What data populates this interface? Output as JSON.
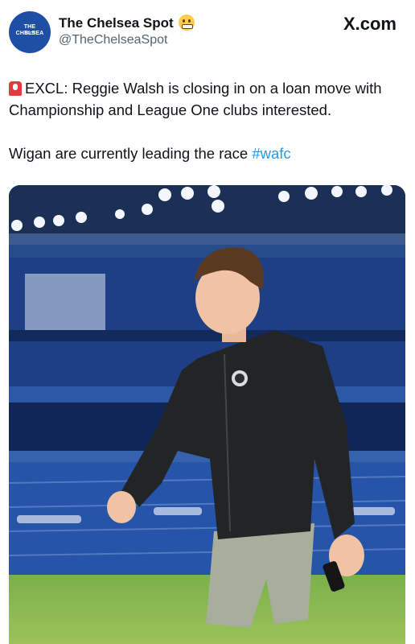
{
  "header": {
    "display_name": "The Chelsea Spot",
    "handle": "@TheChelseaSpot",
    "platform_logo": "X.com",
    "avatar": {
      "line1": "THE",
      "line2": "CHELSEA",
      "line3": "SPOT"
    },
    "emoji_icon": "grimacing-face-icon"
  },
  "tweet": {
    "siren_icon": "police-light-icon",
    "line1": "EXCL: Reggie Walsh is closing in on a loan move with Championship and League One clubs interested.",
    "line2_text": "Wigan are currently leading the race ",
    "hashtag": "#wafc"
  },
  "photo": {
    "description_icon": "player-photo-image"
  },
  "colors": {
    "text_primary": "#0f1419",
    "text_secondary": "#536471",
    "hashtag": "#1d9bf0",
    "chelsea_blue": "#1f4fa5"
  }
}
